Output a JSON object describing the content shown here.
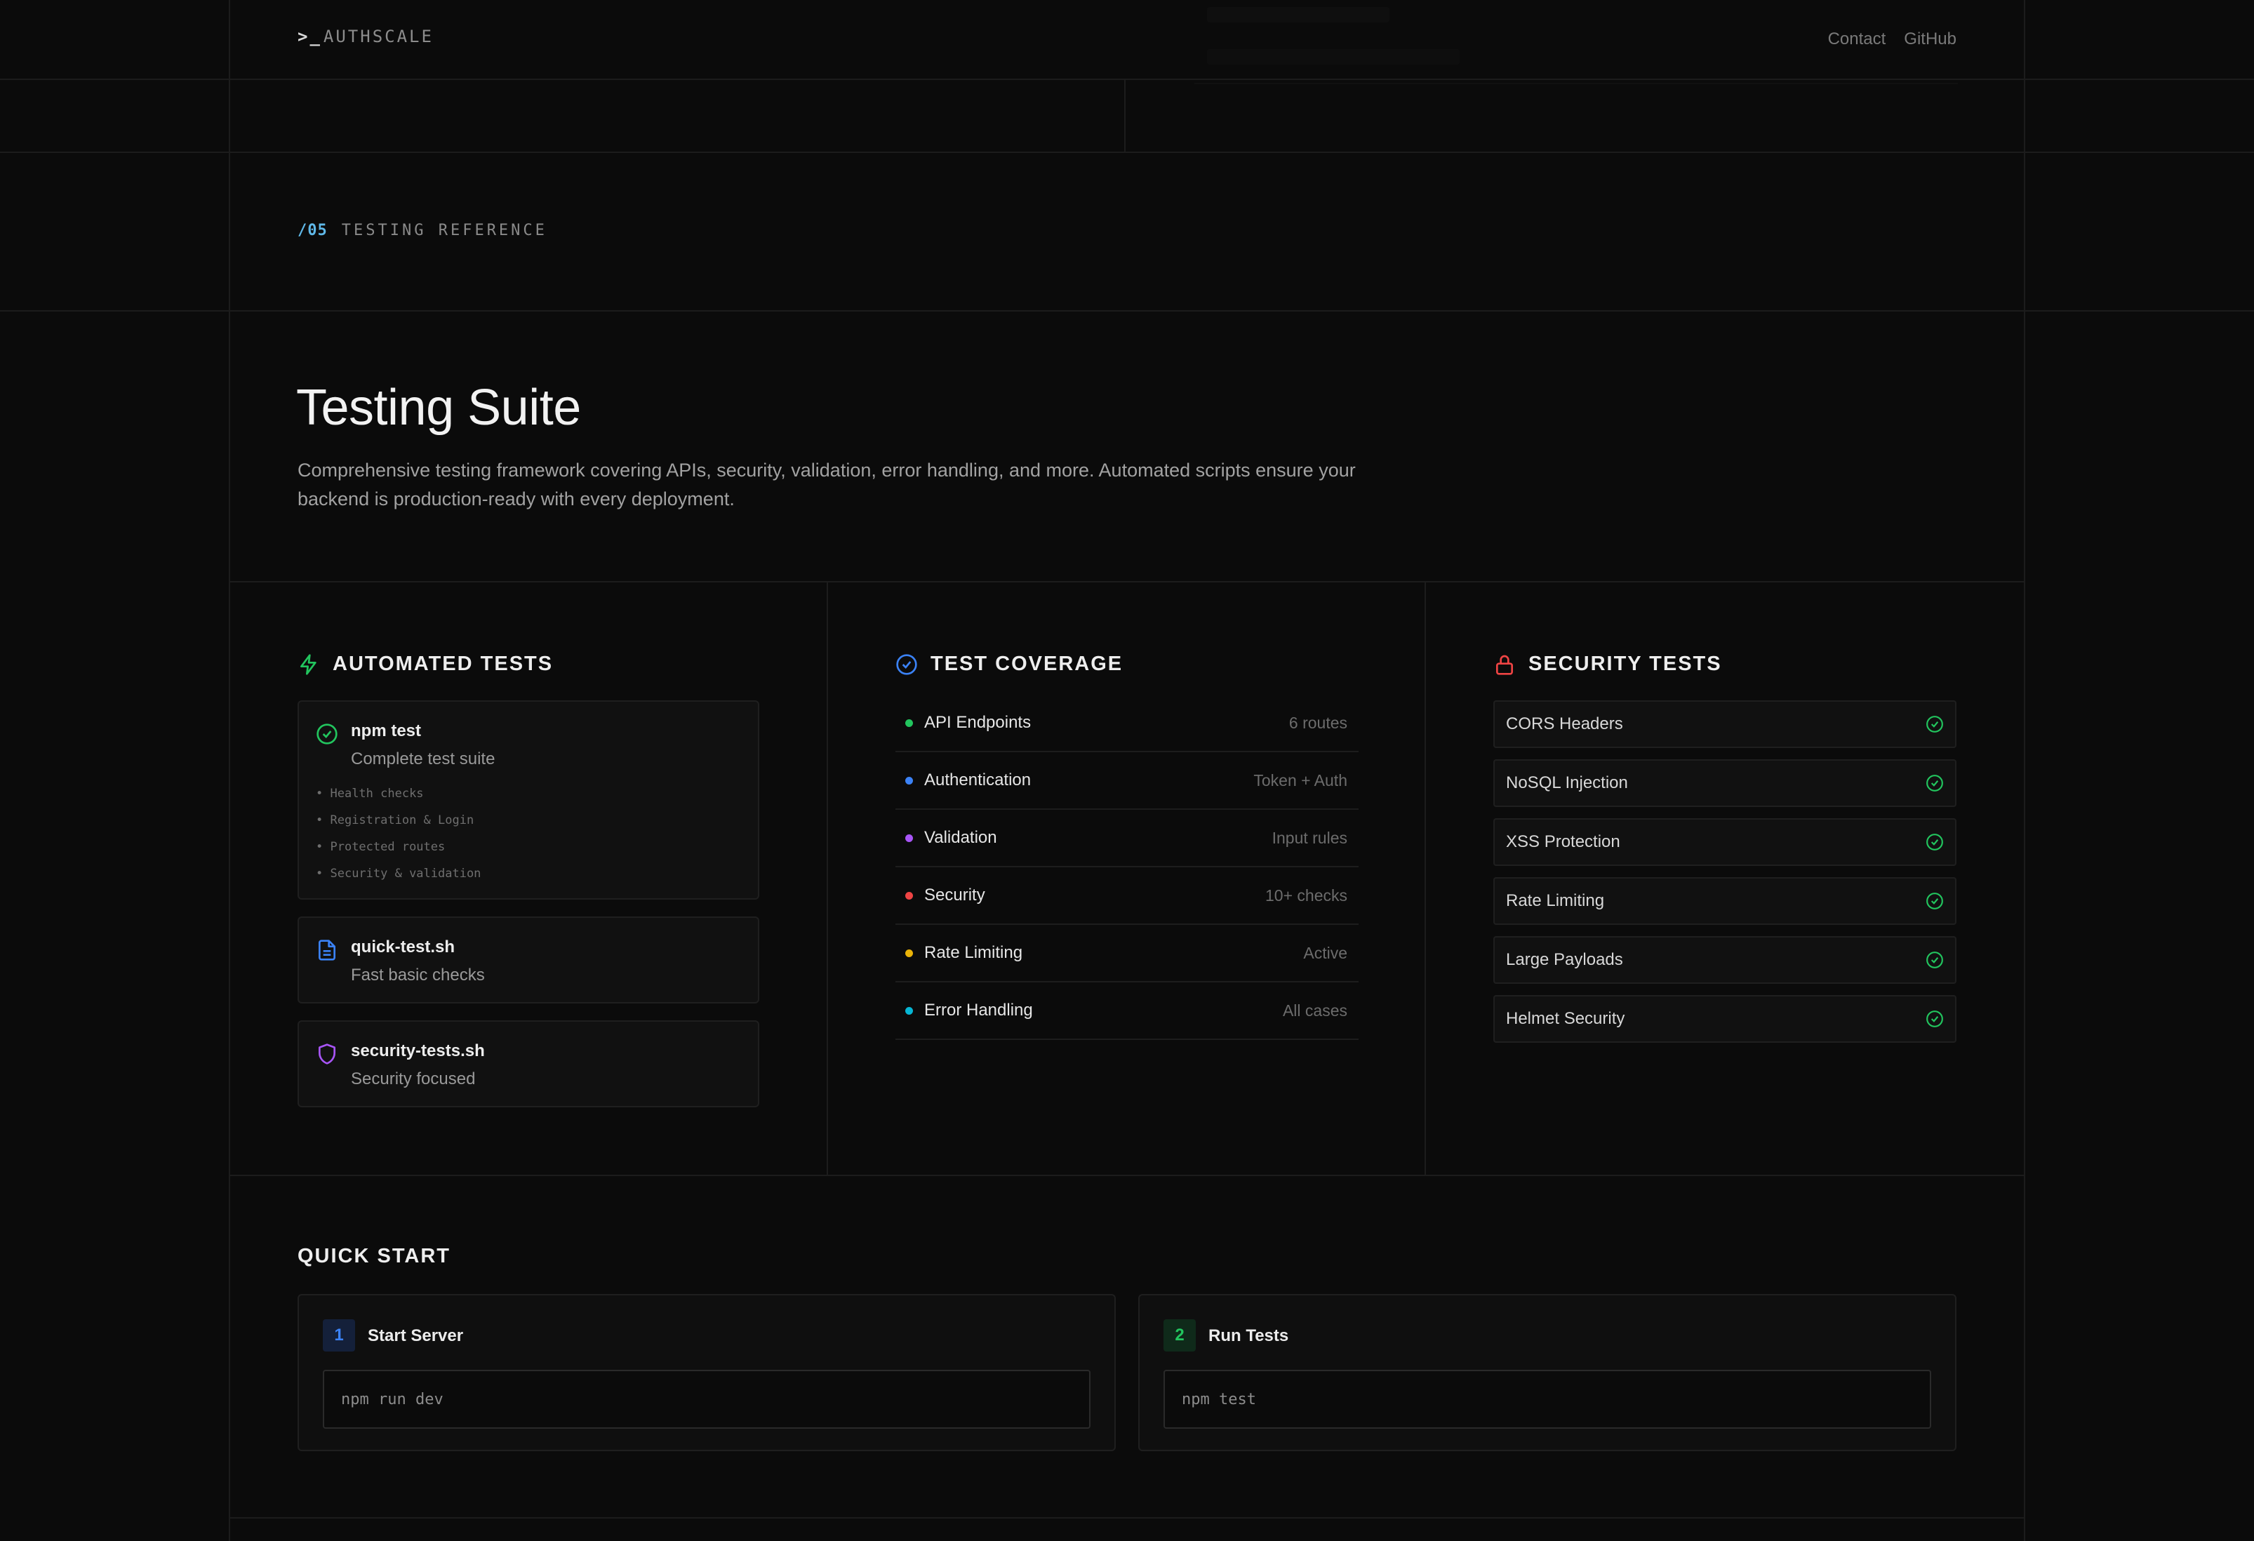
{
  "header": {
    "logo_prompt": ">_",
    "logo_text": "AUTHSCALE",
    "nav": [
      "Contact",
      "GitHub"
    ]
  },
  "section": {
    "number": "/05",
    "label": "TESTING REFERENCE"
  },
  "hero": {
    "title": "Testing Suite",
    "description": "Comprehensive testing framework covering APIs, security, validation, error handling, and more. Automated scripts ensure your backend is production-ready with every deployment."
  },
  "automated": {
    "heading": "AUTOMATED TESTS",
    "cards": [
      {
        "title": "npm test",
        "subtitle": "Complete test suite",
        "icon": "check-circle-icon",
        "items": [
          "Health checks",
          "Registration & Login",
          "Protected routes",
          "Security & validation"
        ]
      },
      {
        "title": "quick-test.sh",
        "subtitle": "Fast basic checks",
        "icon": "file-icon"
      },
      {
        "title": "security-tests.sh",
        "subtitle": "Security focused",
        "icon": "shield-icon"
      }
    ]
  },
  "coverage": {
    "heading": "TEST COVERAGE",
    "rows": [
      {
        "name": "API Endpoints",
        "value": "6 routes",
        "color": "#22c55e"
      },
      {
        "name": "Authentication",
        "value": "Token + Auth",
        "color": "#3b82f6"
      },
      {
        "name": "Validation",
        "value": "Input rules",
        "color": "#a855f7"
      },
      {
        "name": "Security",
        "value": "10+ checks",
        "color": "#ef4444"
      },
      {
        "name": "Rate Limiting",
        "value": "Active",
        "color": "#eab308"
      },
      {
        "name": "Error Handling",
        "value": "All cases",
        "color": "#06b6d4"
      }
    ]
  },
  "security": {
    "heading": "SECURITY TESTS",
    "items": [
      "CORS Headers",
      "NoSQL Injection",
      "XSS Protection",
      "Rate Limiting",
      "Large Payloads",
      "Helmet Security"
    ]
  },
  "quickstart": {
    "heading": "QUICK START",
    "steps": [
      {
        "num": "1",
        "label": "Start Server",
        "command": "npm run dev",
        "color": "#3b82f6"
      },
      {
        "num": "2",
        "label": "Run Tests",
        "command": "npm test",
        "color": "#22c55e"
      }
    ]
  },
  "colors": {
    "accent": "#5fb8e8",
    "green": "#22c55e",
    "red": "#ef4444",
    "purple": "#a855f7"
  }
}
